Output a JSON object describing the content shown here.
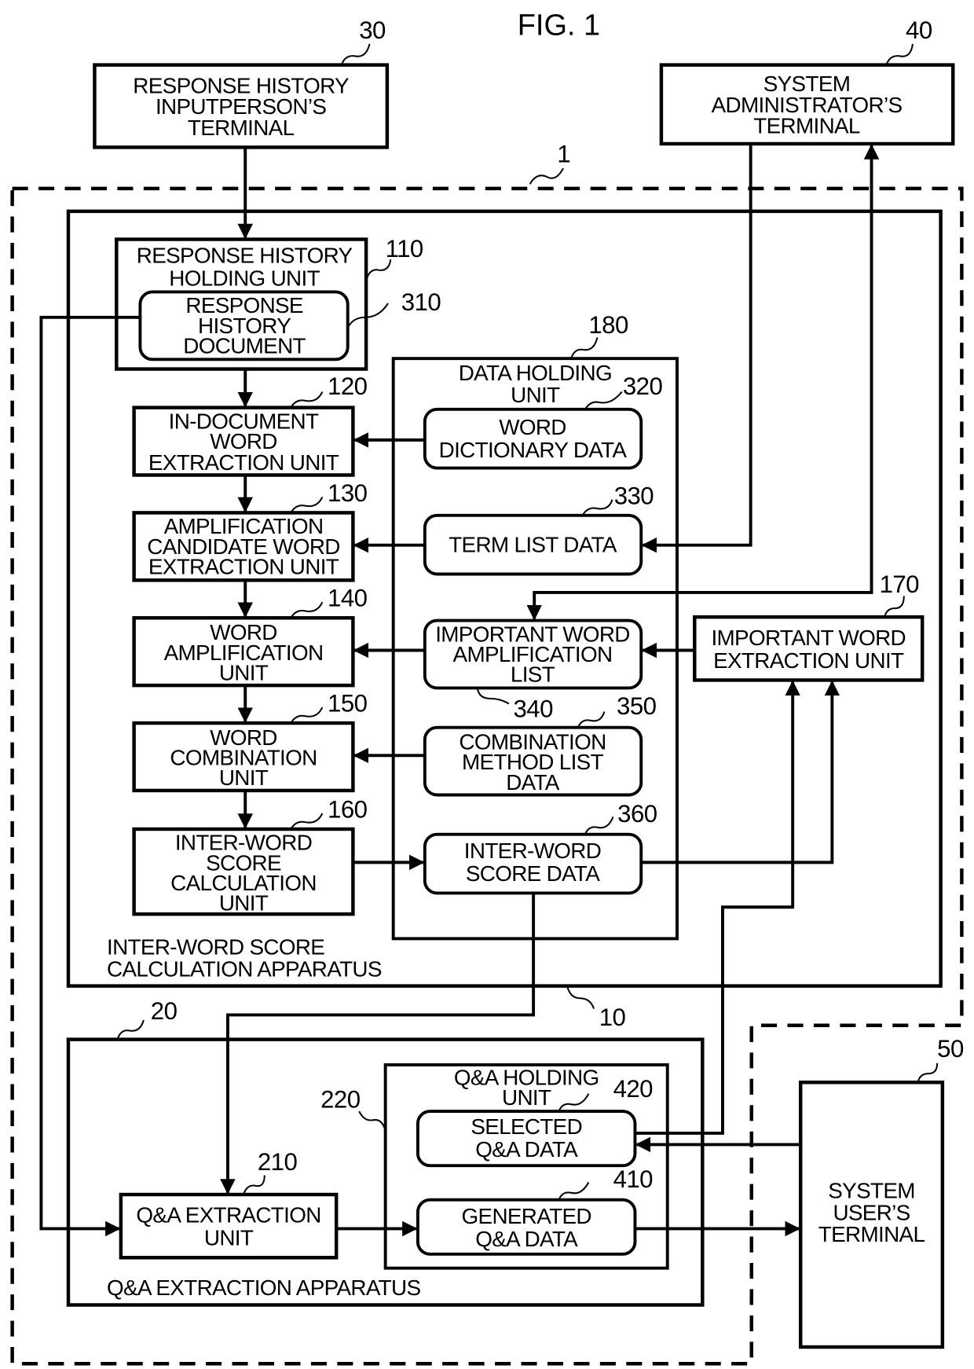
{
  "figure": {
    "title": "FIG. 1",
    "system_ref": "1"
  },
  "terminals": {
    "input_person": {
      "ref": "30",
      "lines": [
        "RESPONSE HISTORY",
        "INPUTPERSON’S",
        "TERMINAL"
      ]
    },
    "admin": {
      "ref": "40",
      "lines": [
        "SYSTEM",
        "ADMINISTRATOR’S",
        "TERMINAL"
      ]
    },
    "user": {
      "ref": "50",
      "lines": [
        "SYSTEM",
        "USER’S",
        "TERMINAL"
      ]
    }
  },
  "score_apparatus": {
    "ref": "10",
    "caption": [
      "INTER-WORD SCORE",
      "CALCULATION APPARATUS"
    ],
    "units": [
      {
        "ref": "110",
        "lines": [
          "RESPONSE HISTORY",
          "HOLDING UNIT"
        ]
      },
      {
        "ref": "120",
        "lines": [
          "IN-DOCUMENT",
          "WORD",
          "EXTRACTION UNIT"
        ]
      },
      {
        "ref": "130",
        "lines": [
          "AMPLIFICATION",
          "CANDIDATE WORD",
          "EXTRACTION UNIT"
        ]
      },
      {
        "ref": "140",
        "lines": [
          "WORD",
          "AMPLIFICATION",
          "UNIT"
        ]
      },
      {
        "ref": "150",
        "lines": [
          "WORD",
          "COMBINATION",
          "UNIT"
        ]
      },
      {
        "ref": "160",
        "lines": [
          "INTER-WORD",
          "SCORE",
          "CALCULATION",
          "UNIT"
        ]
      },
      {
        "ref": "170",
        "lines": [
          "IMPORTANT WORD",
          "EXTRACTION UNIT"
        ]
      }
    ],
    "response_document": {
      "ref": "310",
      "lines": [
        "RESPONSE",
        "HISTORY",
        "DOCUMENT"
      ]
    },
    "data_holding": {
      "ref": "180",
      "lines": [
        "DATA HOLDING",
        "UNIT"
      ],
      "items": [
        {
          "ref": "320",
          "lines": [
            "WORD",
            "DICTIONARY DATA"
          ]
        },
        {
          "ref": "330",
          "lines": [
            "TERM LIST DATA"
          ]
        },
        {
          "ref": "340",
          "lines": [
            "IMPORTANT WORD",
            "AMPLIFICATION",
            "LIST"
          ]
        },
        {
          "ref": "350",
          "lines": [
            "COMBINATION",
            "METHOD LIST",
            "DATA"
          ]
        },
        {
          "ref": "360",
          "lines": [
            "INTER-WORD",
            "SCORE DATA"
          ]
        }
      ]
    }
  },
  "qa_apparatus": {
    "ref": "20",
    "caption": "Q&A EXTRACTION APPARATUS",
    "extraction_unit": {
      "ref": "210",
      "lines": [
        "Q&A EXTRACTION",
        "UNIT"
      ]
    },
    "holding": {
      "ref": "220",
      "lines": [
        "Q&A HOLDING",
        "UNIT"
      ],
      "items": [
        {
          "ref": "420",
          "lines": [
            "SELECTED",
            "Q&A DATA"
          ]
        },
        {
          "ref": "410",
          "lines": [
            "GENERATED",
            "Q&A DATA"
          ]
        }
      ]
    }
  }
}
